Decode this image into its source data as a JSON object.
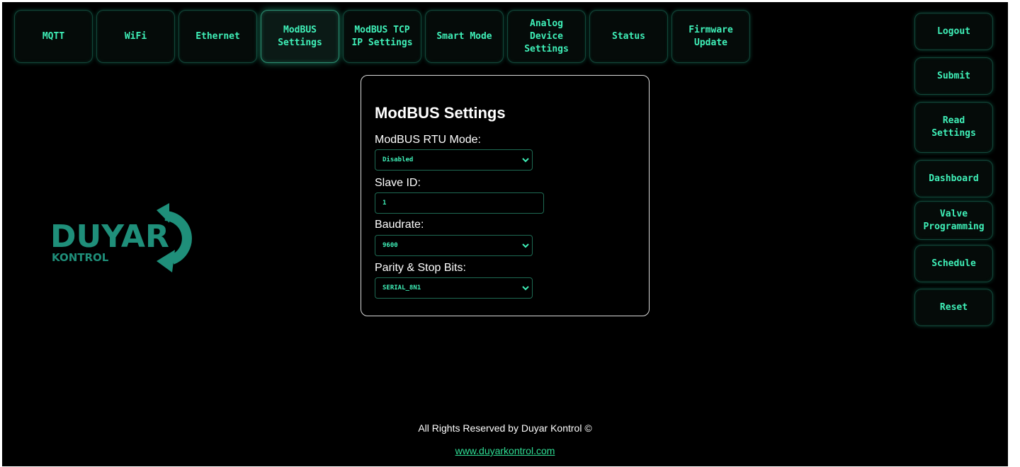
{
  "top_nav": [
    {
      "label": "MQTT",
      "active": false
    },
    {
      "label": "WiFi",
      "active": false
    },
    {
      "label": "Ethernet",
      "active": false
    },
    {
      "label": "ModBUS\nSettings",
      "active": true
    },
    {
      "label": "ModBUS TCP\nIP Settings",
      "active": false
    },
    {
      "label": "Smart Mode",
      "active": false
    },
    {
      "label": "Analog\nDevice\nSettings",
      "active": false
    },
    {
      "label": "Status",
      "active": false
    },
    {
      "label": "Firmware\nUpdate",
      "active": false
    }
  ],
  "side_nav": [
    {
      "label": "Logout"
    },
    {
      "label": "Submit"
    },
    {
      "label": "Read\nSettings"
    },
    {
      "label": "Dashboard"
    },
    {
      "label": "Valve\nProgramming"
    },
    {
      "label": "Schedule"
    },
    {
      "label": "Reset"
    }
  ],
  "logo": {
    "brand": "DUYAR",
    "sub": "KONTROL"
  },
  "form": {
    "title": "ModBUS Settings",
    "rtu_mode": {
      "label": "ModBUS RTU Mode:",
      "value": "Disabled"
    },
    "slave_id": {
      "label": "Slave ID:",
      "value": "1"
    },
    "baudrate": {
      "label": "Baudrate:",
      "value": "9600"
    },
    "parity": {
      "label": "Parity & Stop Bits:",
      "value": "SERIAL_8N1"
    }
  },
  "footer": {
    "copyright": "All Rights Reserved by Duyar Kontrol ©",
    "link": "www.duyarkontrol.com"
  },
  "colors": {
    "accent": "#3ff0b8",
    "logo_teal": "#1f8f7a",
    "background": "#000000",
    "link": "#2edc93"
  }
}
